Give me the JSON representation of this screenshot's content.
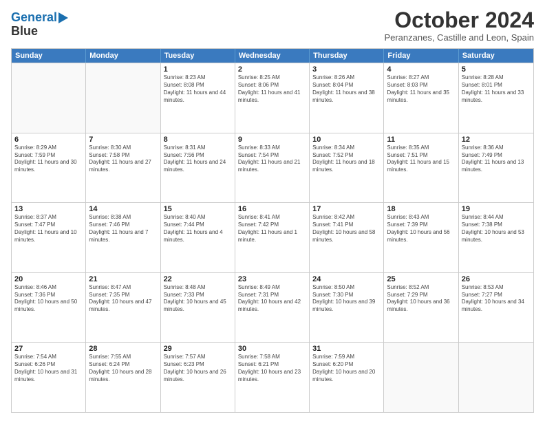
{
  "header": {
    "logo_line1": "General",
    "logo_line2": "Blue",
    "month_title": "October 2024",
    "location": "Peranzanes, Castille and Leon, Spain"
  },
  "days_of_week": [
    "Sunday",
    "Monday",
    "Tuesday",
    "Wednesday",
    "Thursday",
    "Friday",
    "Saturday"
  ],
  "weeks": [
    [
      {
        "day": "",
        "info": ""
      },
      {
        "day": "",
        "info": ""
      },
      {
        "day": "1",
        "info": "Sunrise: 8:23 AM\nSunset: 8:08 PM\nDaylight: 11 hours and 44 minutes."
      },
      {
        "day": "2",
        "info": "Sunrise: 8:25 AM\nSunset: 8:06 PM\nDaylight: 11 hours and 41 minutes."
      },
      {
        "day": "3",
        "info": "Sunrise: 8:26 AM\nSunset: 8:04 PM\nDaylight: 11 hours and 38 minutes."
      },
      {
        "day": "4",
        "info": "Sunrise: 8:27 AM\nSunset: 8:03 PM\nDaylight: 11 hours and 35 minutes."
      },
      {
        "day": "5",
        "info": "Sunrise: 8:28 AM\nSunset: 8:01 PM\nDaylight: 11 hours and 33 minutes."
      }
    ],
    [
      {
        "day": "6",
        "info": "Sunrise: 8:29 AM\nSunset: 7:59 PM\nDaylight: 11 hours and 30 minutes."
      },
      {
        "day": "7",
        "info": "Sunrise: 8:30 AM\nSunset: 7:58 PM\nDaylight: 11 hours and 27 minutes."
      },
      {
        "day": "8",
        "info": "Sunrise: 8:31 AM\nSunset: 7:56 PM\nDaylight: 11 hours and 24 minutes."
      },
      {
        "day": "9",
        "info": "Sunrise: 8:33 AM\nSunset: 7:54 PM\nDaylight: 11 hours and 21 minutes."
      },
      {
        "day": "10",
        "info": "Sunrise: 8:34 AM\nSunset: 7:52 PM\nDaylight: 11 hours and 18 minutes."
      },
      {
        "day": "11",
        "info": "Sunrise: 8:35 AM\nSunset: 7:51 PM\nDaylight: 11 hours and 15 minutes."
      },
      {
        "day": "12",
        "info": "Sunrise: 8:36 AM\nSunset: 7:49 PM\nDaylight: 11 hours and 13 minutes."
      }
    ],
    [
      {
        "day": "13",
        "info": "Sunrise: 8:37 AM\nSunset: 7:47 PM\nDaylight: 11 hours and 10 minutes."
      },
      {
        "day": "14",
        "info": "Sunrise: 8:38 AM\nSunset: 7:46 PM\nDaylight: 11 hours and 7 minutes."
      },
      {
        "day": "15",
        "info": "Sunrise: 8:40 AM\nSunset: 7:44 PM\nDaylight: 11 hours and 4 minutes."
      },
      {
        "day": "16",
        "info": "Sunrise: 8:41 AM\nSunset: 7:42 PM\nDaylight: 11 hours and 1 minute."
      },
      {
        "day": "17",
        "info": "Sunrise: 8:42 AM\nSunset: 7:41 PM\nDaylight: 10 hours and 58 minutes."
      },
      {
        "day": "18",
        "info": "Sunrise: 8:43 AM\nSunset: 7:39 PM\nDaylight: 10 hours and 56 minutes."
      },
      {
        "day": "19",
        "info": "Sunrise: 8:44 AM\nSunset: 7:38 PM\nDaylight: 10 hours and 53 minutes."
      }
    ],
    [
      {
        "day": "20",
        "info": "Sunrise: 8:46 AM\nSunset: 7:36 PM\nDaylight: 10 hours and 50 minutes."
      },
      {
        "day": "21",
        "info": "Sunrise: 8:47 AM\nSunset: 7:35 PM\nDaylight: 10 hours and 47 minutes."
      },
      {
        "day": "22",
        "info": "Sunrise: 8:48 AM\nSunset: 7:33 PM\nDaylight: 10 hours and 45 minutes."
      },
      {
        "day": "23",
        "info": "Sunrise: 8:49 AM\nSunset: 7:31 PM\nDaylight: 10 hours and 42 minutes."
      },
      {
        "day": "24",
        "info": "Sunrise: 8:50 AM\nSunset: 7:30 PM\nDaylight: 10 hours and 39 minutes."
      },
      {
        "day": "25",
        "info": "Sunrise: 8:52 AM\nSunset: 7:29 PM\nDaylight: 10 hours and 36 minutes."
      },
      {
        "day": "26",
        "info": "Sunrise: 8:53 AM\nSunset: 7:27 PM\nDaylight: 10 hours and 34 minutes."
      }
    ],
    [
      {
        "day": "27",
        "info": "Sunrise: 7:54 AM\nSunset: 6:26 PM\nDaylight: 10 hours and 31 minutes."
      },
      {
        "day": "28",
        "info": "Sunrise: 7:55 AM\nSunset: 6:24 PM\nDaylight: 10 hours and 28 minutes."
      },
      {
        "day": "29",
        "info": "Sunrise: 7:57 AM\nSunset: 6:23 PM\nDaylight: 10 hours and 26 minutes."
      },
      {
        "day": "30",
        "info": "Sunrise: 7:58 AM\nSunset: 6:21 PM\nDaylight: 10 hours and 23 minutes."
      },
      {
        "day": "31",
        "info": "Sunrise: 7:59 AM\nSunset: 6:20 PM\nDaylight: 10 hours and 20 minutes."
      },
      {
        "day": "",
        "info": ""
      },
      {
        "day": "",
        "info": ""
      }
    ]
  ]
}
